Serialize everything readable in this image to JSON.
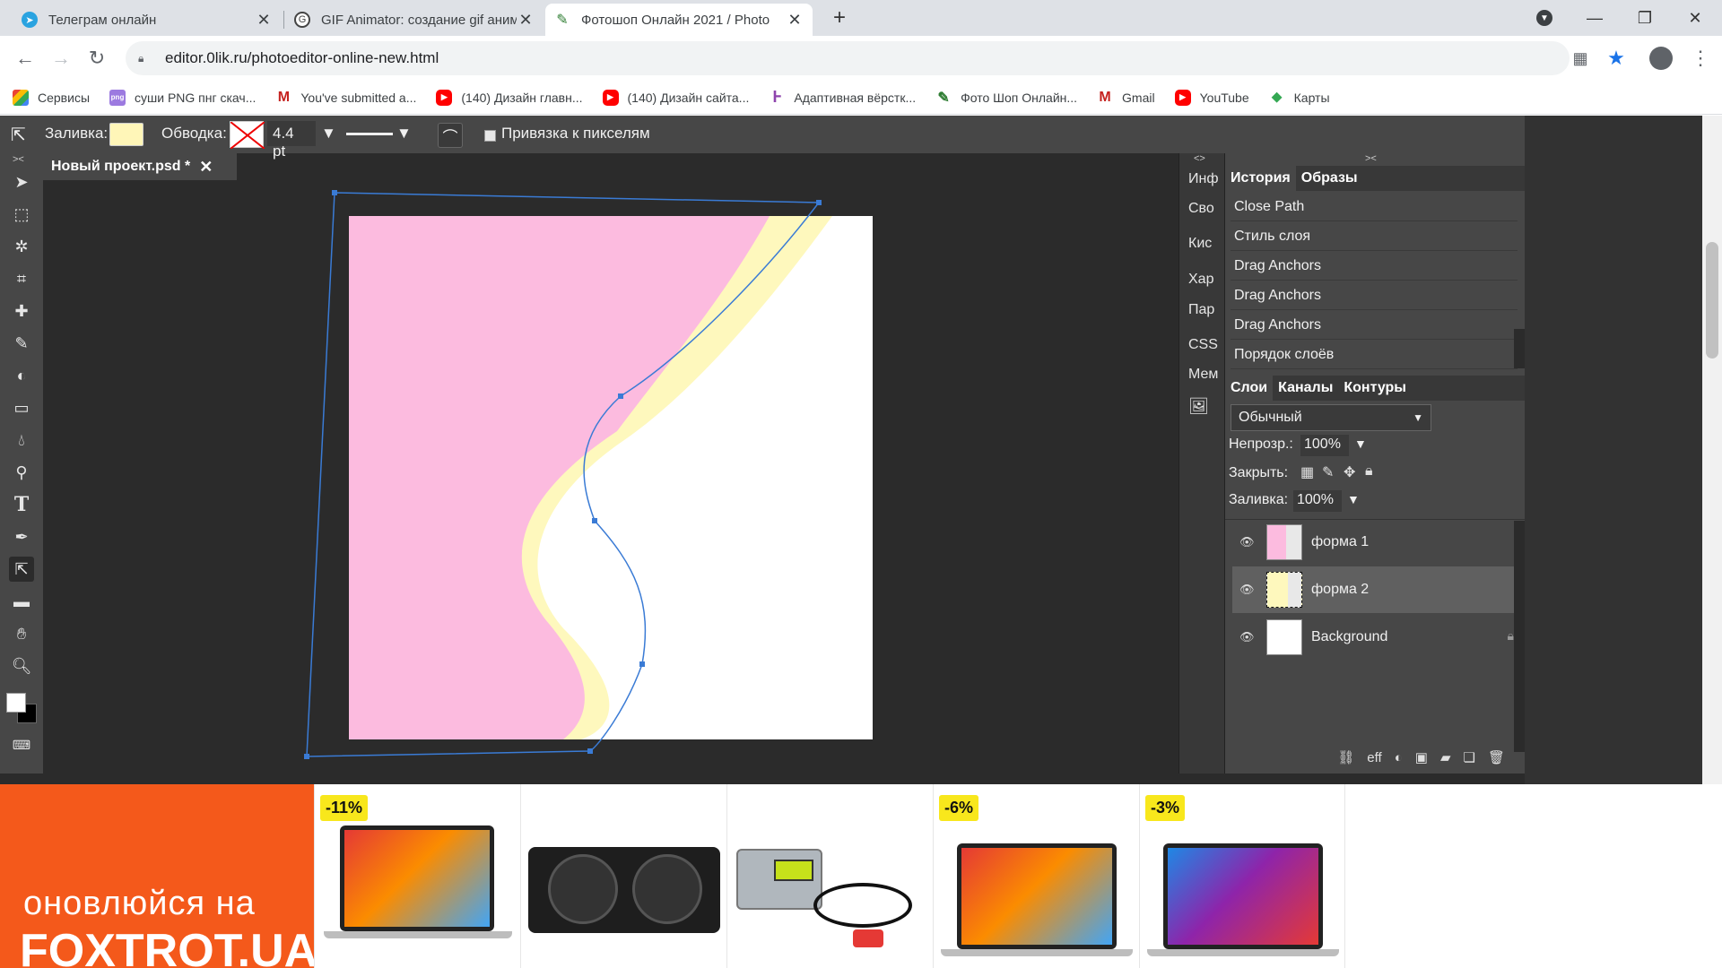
{
  "browser": {
    "tabs": [
      {
        "title": "Телеграм онлайн",
        "active": false
      },
      {
        "title": "GIF Animator: создание gif аним",
        "active": false
      },
      {
        "title": "Фотошоп Онлайн 2021 / Photo",
        "active": true
      }
    ],
    "new_tab": "+",
    "url": "editor.0lik.ru/photoeditor-online-new.html",
    "bookmarks": [
      "Сервисы",
      "суши PNG пнг скач...",
      "You've submitted a...",
      "(140) Дизайн главн...",
      "(140) Дизайн сайта...",
      "Адаптивная вёрстк...",
      "Фото Шоп Онлайн...",
      "Gmail",
      "YouTube",
      "Карты"
    ]
  },
  "options": {
    "fill_label": "Заливка:",
    "stroke_label": "Обводка:",
    "stroke_width": "4.4 pt",
    "snap_label": "Привязка к пикселям",
    "fill_color": "#fff6b8"
  },
  "document": {
    "tab_title": "Новый проект.psd *",
    "colors": {
      "pink": "#fcbbdf",
      "yellow": "#fef8bd",
      "path": "#3a7bd5"
    }
  },
  "side_tabs": [
    "Инф",
    "Сво",
    "Кис",
    "Хар",
    "Пар",
    "CSS",
    "Мем"
  ],
  "history_panel": {
    "tabs": [
      "История",
      "Образы"
    ],
    "items": [
      "Close Path",
      "Стиль слоя",
      "Drag Anchors",
      "Drag Anchors",
      "Drag Anchors",
      "Порядок слоёв"
    ]
  },
  "layers_panel": {
    "tabs": [
      "Слои",
      "Каналы",
      "Контуры"
    ],
    "blend_mode": "Обычный",
    "opacity_label": "Непрозр.:",
    "opacity": "100%",
    "lock_label": "Закрыть:",
    "fill_label": "Заливка:",
    "fill": "100%",
    "layers": [
      "форма 1",
      "форма 2",
      "Background"
    ],
    "footer_eff": "eff"
  },
  "ad": {
    "line1": "оновлюйся на",
    "line2": "FOXTROT.UA",
    "badges": [
      "-11%",
      "-6%",
      "-3%"
    ]
  }
}
